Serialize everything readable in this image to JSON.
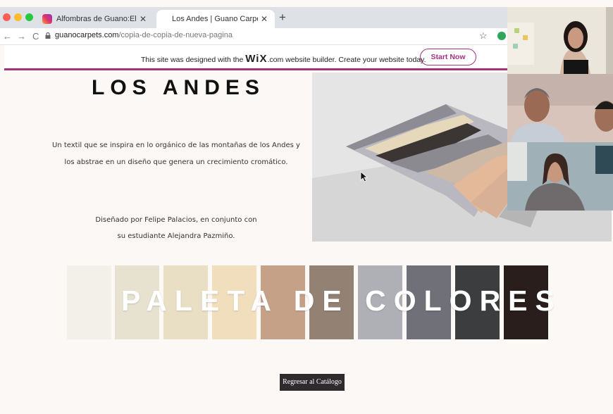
{
  "browser": {
    "tabs": [
      {
        "label": "Alfombras de Guano:El Proyec",
        "active": false
      },
      {
        "label": "Los Andes | Guano Carpets",
        "active": true
      }
    ],
    "new_tab": "+",
    "close_glyph": "✕",
    "nav": {
      "back": "←",
      "forward": "→",
      "reload": "C"
    },
    "url_host": "guanocarpets.com",
    "url_path": "/copia-de-copia-de-nueva-pagina",
    "star": "☆"
  },
  "wix_banner": {
    "text_before": "This site was designed with the ",
    "brand": "WiX",
    "text_after": ".com website builder. Create your website today.",
    "button": "Start Now",
    "accent": "#a4327f"
  },
  "page": {
    "title": "LOS ANDES",
    "description_line1": "Un textil que se inspira en lo orgánico de las montañas de los Andes y",
    "description_line2": "los abstrae en un diseño que genera un crecimiento cromático.",
    "credit_line1": "Diseñado por Felipe Palacios, en conjunto con",
    "credit_line2": "su estudiante Alejandra Pazmiño.",
    "palette_title": "PALETA DE COLORES",
    "palette_colors": [
      "#f3f0ea",
      "#e7e2d0",
      "#e9dfc5",
      "#f0debd",
      "#c5a188",
      "#938174",
      "#aeb0b6",
      "#6f7078",
      "#3b3d3f",
      "#2a1e1c"
    ],
    "back_button": "Regresar al Catálogo"
  },
  "video_call": {
    "participants": [
      {
        "name": "participant-1"
      },
      {
        "name": "participant-2"
      },
      {
        "name": "participant-3"
      }
    ]
  }
}
